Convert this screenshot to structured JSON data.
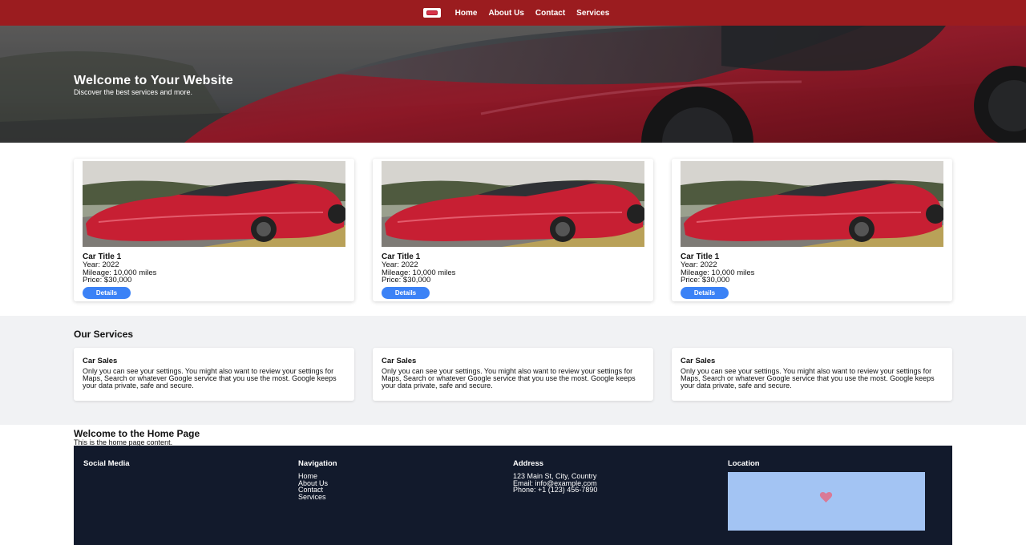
{
  "nav": {
    "items": [
      "Home",
      "About Us",
      "Contact",
      "Services"
    ]
  },
  "hero": {
    "title": "Welcome to Your Website",
    "subtitle": "Discover the best services and more."
  },
  "cars": [
    {
      "title": "Car Title 1",
      "year": "Year: 2022",
      "mileage": "Mileage: 10,000 miles",
      "price": "Price: $30,000",
      "button": "Details"
    },
    {
      "title": "Car Title 1",
      "year": "Year: 2022",
      "mileage": "Mileage: 10,000 miles",
      "price": "Price: $30,000",
      "button": "Details"
    },
    {
      "title": "Car Title 1",
      "year": "Year: 2022",
      "mileage": "Mileage: 10,000 miles",
      "price": "Price: $30,000",
      "button": "Details"
    }
  ],
  "services": {
    "title": "Our Services",
    "items": [
      {
        "title": "Car Sales",
        "text": "Only you can see your settings. You might also want to review your settings for Maps, Search or whatever Google service that you use the most. Google keeps your data private, safe and secure."
      },
      {
        "title": "Car Sales",
        "text": "Only you can see your settings. You might also want to review your settings for Maps, Search or whatever Google service that you use the most. Google keeps your data private, safe and secure."
      },
      {
        "title": "Car Sales",
        "text": "Only you can see your settings. You might also want to review your settings for Maps, Search or whatever Google service that you use the most. Google keeps your data private, safe and secure."
      }
    ]
  },
  "welcome": {
    "title": "Welcome to the Home Page",
    "text": "This is the home page content."
  },
  "footer": {
    "social_heading": "Social Media",
    "nav_heading": "Navigation",
    "nav_links": [
      "Home",
      "About Us",
      "Contact",
      "Services"
    ],
    "address_heading": "Address",
    "address_lines": [
      "123 Main St, City, Country",
      "Email: info@example.com",
      "Phone: +1 (123) 456-7890"
    ],
    "location_heading": "Location"
  },
  "colors": {
    "nav_bg": "#9b1c1f",
    "button": "#3b82f6",
    "footer_bg": "#121a2c",
    "services_bg": "#f1f2f4",
    "map": "#a3c4f3"
  },
  "icons": {
    "logo": "car-logo-icon",
    "map_pin": "map-pin-icon"
  }
}
